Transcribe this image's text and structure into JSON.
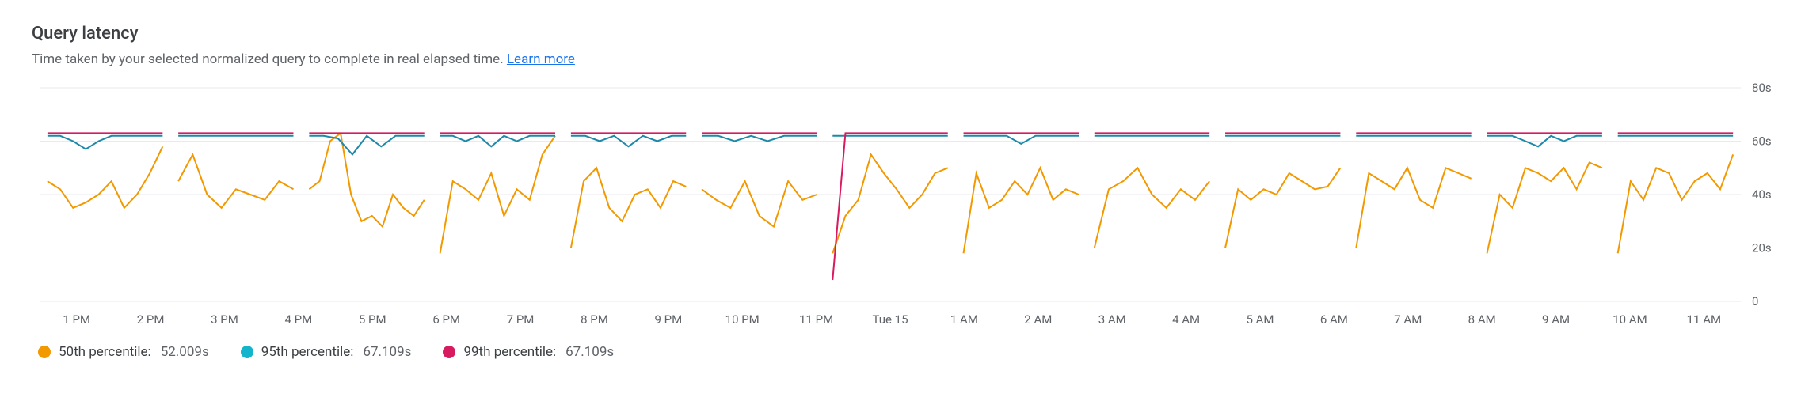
{
  "header": {
    "title": "Query latency",
    "subtitle_prefix": "Time taken by your selected normalized query to complete in real elapsed time. ",
    "learn_more": "Learn more"
  },
  "legend": {
    "p50_label": "50th percentile:",
    "p50_value": "52.009s",
    "p95_label": "95th percentile:",
    "p95_value": "67.109s",
    "p99_label": "99th percentile:",
    "p99_value": "67.109s"
  },
  "chart_data": {
    "type": "line",
    "title": "Query latency",
    "xlabel": "",
    "ylabel": "",
    "ylim": [
      0,
      80
    ],
    "y_ticks": [
      0,
      "20s",
      "40s",
      "60s",
      "80s"
    ],
    "categories": [
      "1 PM",
      "2 PM",
      "3 PM",
      "4 PM",
      "5 PM",
      "6 PM",
      "7 PM",
      "8 PM",
      "9 PM",
      "10 PM",
      "11 PM",
      "Tue 15",
      "1 AM",
      "2 AM",
      "3 AM",
      "4 AM",
      "5 AM",
      "6 AM",
      "7 AM",
      "8 AM",
      "9 AM",
      "10 AM",
      "11 AM"
    ],
    "series": [
      {
        "name": "50th percentile",
        "color": "#f29900",
        "current": 52.009,
        "values": [
          [
            45,
            42,
            35,
            37,
            40,
            45,
            35,
            40,
            48,
            58
          ],
          [
            45,
            55,
            40,
            35,
            42,
            40,
            38,
            45,
            42
          ],
          [
            42,
            45,
            60,
            63,
            40,
            30,
            32,
            28,
            40,
            35,
            32,
            38
          ],
          [
            18,
            45,
            42,
            38,
            48,
            32,
            42,
            38,
            55,
            62
          ],
          [
            20,
            45,
            50,
            35,
            30,
            40,
            42,
            35,
            45,
            43
          ],
          [
            42,
            38,
            35,
            45,
            32,
            28,
            45,
            38,
            40
          ],
          [
            18,
            32,
            38,
            55,
            48,
            42,
            35,
            40,
            48,
            50
          ],
          [
            18,
            48,
            35,
            38,
            45,
            40,
            50,
            38,
            42,
            40
          ],
          [
            20,
            42,
            45,
            50,
            40,
            35,
            42,
            38,
            45
          ],
          [
            20,
            42,
            38,
            42,
            40,
            48,
            45,
            42,
            43,
            50
          ],
          [
            20,
            48,
            45,
            42,
            50,
            38,
            35,
            50,
            48,
            46
          ],
          [
            18,
            40,
            35,
            50,
            48,
            45,
            50,
            42,
            52,
            50
          ],
          [
            18,
            45,
            38,
            50,
            48,
            38,
            45,
            48,
            42,
            55
          ]
        ]
      },
      {
        "name": "95th percentile",
        "color": "#12b5cb",
        "current": 67.109,
        "values": [
          [
            62,
            62,
            60,
            57,
            60,
            62,
            62,
            62,
            62,
            62
          ],
          [
            62,
            62,
            62,
            62,
            62,
            62,
            62,
            62
          ],
          [
            62,
            62,
            61,
            55,
            62,
            58,
            62,
            62,
            62
          ],
          [
            62,
            62,
            60,
            62,
            58,
            62,
            60,
            62,
            62,
            62
          ],
          [
            62,
            62,
            60,
            62,
            58,
            62,
            60,
            62,
            62
          ],
          [
            62,
            62,
            60,
            62,
            60,
            62,
            62,
            62
          ],
          [
            62,
            62,
            62,
            62,
            62,
            62,
            62,
            62,
            62
          ],
          [
            62,
            62,
            62,
            62,
            59,
            62,
            62,
            62,
            62
          ],
          [
            62,
            62,
            62,
            62,
            62,
            62,
            62,
            62
          ],
          [
            62,
            62,
            62,
            62,
            62,
            62,
            62,
            62,
            62
          ],
          [
            62,
            62,
            62,
            62,
            62,
            62,
            62,
            62,
            62
          ],
          [
            62,
            62,
            62,
            60,
            58,
            62,
            60,
            62,
            62,
            62
          ],
          [
            62,
            62,
            62,
            62,
            62,
            62,
            62,
            62,
            62
          ]
        ]
      },
      {
        "name": "99th percentile",
        "color": "#d81b60",
        "current": 67.109,
        "values": [
          [
            63,
            63,
            63,
            63,
            63,
            63,
            63,
            63,
            63,
            63
          ],
          [
            63,
            63,
            63,
            63,
            63,
            63,
            63,
            63
          ],
          [
            63,
            63,
            63,
            63,
            63,
            63,
            63,
            63,
            63
          ],
          [
            63,
            63,
            63,
            63,
            63,
            63,
            63,
            63,
            63,
            63
          ],
          [
            63,
            63,
            63,
            63,
            63,
            63,
            63,
            63,
            63
          ],
          [
            63,
            63,
            63,
            63,
            63,
            63,
            63,
            63
          ],
          [
            8,
            63,
            63,
            63,
            63,
            63,
            63,
            63,
            63,
            63
          ],
          [
            63,
            63,
            63,
            63,
            63,
            63,
            63,
            63,
            63
          ],
          [
            63,
            63,
            63,
            63,
            63,
            63,
            63,
            63
          ],
          [
            63,
            63,
            63,
            63,
            63,
            63,
            63,
            63,
            63
          ],
          [
            63,
            63,
            63,
            63,
            63,
            63,
            63,
            63,
            63
          ],
          [
            63,
            63,
            63,
            63,
            63,
            63,
            63,
            63,
            63,
            63
          ],
          [
            63,
            63,
            63,
            63,
            63,
            63,
            63,
            63,
            63
          ]
        ]
      }
    ]
  }
}
